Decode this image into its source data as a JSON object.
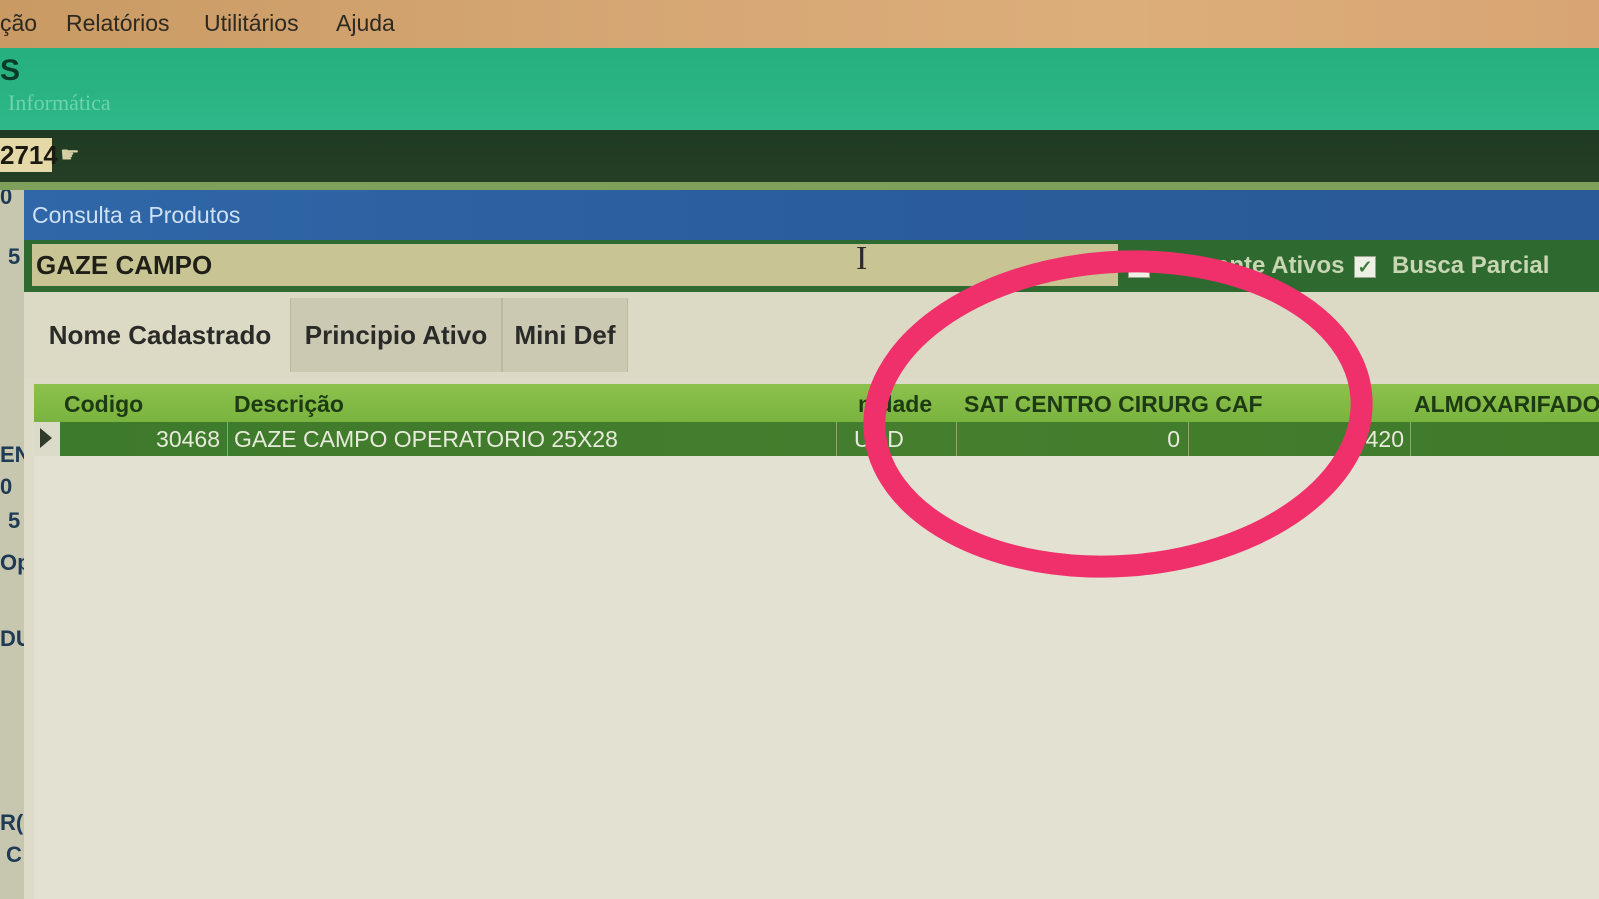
{
  "menu": {
    "items": [
      "ção",
      "Relatórios",
      "Utilitários",
      "Ajuda"
    ]
  },
  "banner": {
    "title_fragment": "S",
    "subtitle_fragment": "Informática"
  },
  "toolbar": {
    "number": "2714",
    "hand_icon": "pointing-hand-icon"
  },
  "left_strip": [
    "0",
    "5",
    "EN",
    "0",
    "5",
    "Op",
    "DU",
    "R(",
    "C"
  ],
  "dialog": {
    "title": "Consulta a Produtos",
    "search": {
      "value": "GAZE CAMPO",
      "placeholder": ""
    },
    "checkboxes": [
      {
        "label": "Somente Ativos",
        "visible_label": "So...nte Ativos",
        "checked": true
      },
      {
        "label": "Busca Parcial",
        "checked": true
      }
    ],
    "tabs": [
      {
        "label": "Nome Cadastrado",
        "active": true
      },
      {
        "label": "Principio Ativo",
        "active": false
      },
      {
        "label": "Mini Def",
        "active": false
      }
    ],
    "grid": {
      "columns": [
        "Codigo",
        "Descrição",
        "nidade",
        "SAT CENTRO CIRURG CAF",
        "ALMOXARIFADO"
      ],
      "rows": [
        {
          "codigo": "30468",
          "descricao": "GAZE CAMPO OPERATORIO 25X28",
          "unidade": "UND",
          "sat": "0",
          "almox": "420"
        }
      ]
    }
  },
  "colors": {
    "annotation": "#f0306b",
    "titlebar": "#2f67a8",
    "grid_header": "#8cc24c",
    "selected_row": "#3e7a2b"
  }
}
